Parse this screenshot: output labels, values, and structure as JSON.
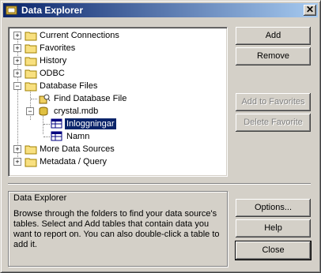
{
  "window": {
    "title": "Data Explorer",
    "close_glyph": "✕"
  },
  "tree": {
    "items": [
      {
        "label": "Current Connections",
        "expander": "+"
      },
      {
        "label": "Favorites",
        "expander": "+"
      },
      {
        "label": "History",
        "expander": "+"
      },
      {
        "label": "ODBC",
        "expander": "+"
      },
      {
        "label": "Database Files",
        "expander": "−"
      },
      {
        "label": "Find Database File"
      },
      {
        "label": "crystal.mdb",
        "expander": "−"
      },
      {
        "label": "Inloggningar",
        "selected": true
      },
      {
        "label": "Namn"
      },
      {
        "label": "More Data Sources",
        "expander": "+"
      },
      {
        "label": "Metadata / Query",
        "expander": "+"
      }
    ]
  },
  "buttons": {
    "add": "Add",
    "remove": "Remove",
    "add_favorites": "Add to Favorites",
    "delete_favorite": "Delete Favorite",
    "options": "Options...",
    "help": "Help",
    "close": "Close"
  },
  "info": {
    "title": "Data Explorer",
    "text": "Browse through the folders to find your data source's tables.  Select and Add tables that contain data you want to report on.  You can also double-click a table to add it."
  },
  "colors": {
    "selection": "#0a246a",
    "titlebar_start": "#0a246a",
    "titlebar_end": "#a6caf0",
    "face": "#d4d0c8"
  }
}
